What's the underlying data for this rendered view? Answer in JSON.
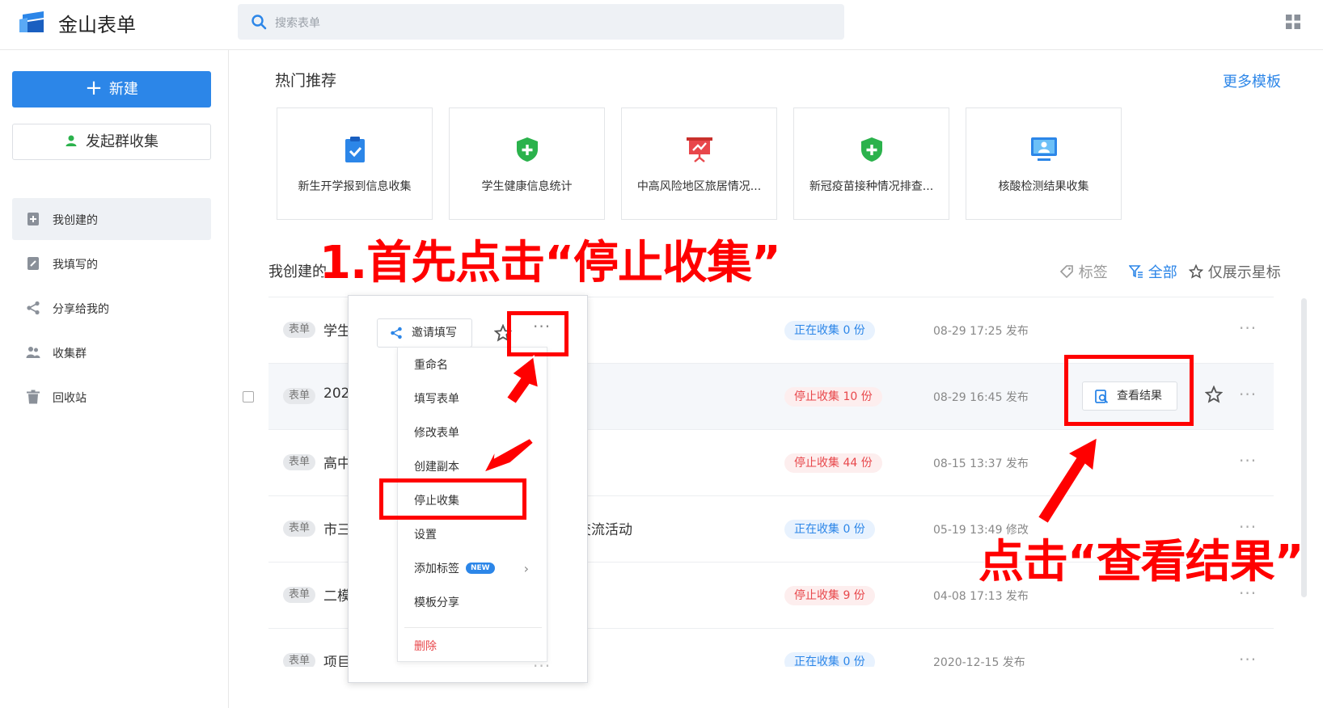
{
  "header": {
    "app_title": "金山表单",
    "search_placeholder": "搜索表单"
  },
  "sidebar": {
    "new_button": "新建",
    "group_collect_button": "发起群收集",
    "items": [
      {
        "label": "我创建的",
        "icon": "form-add-icon"
      },
      {
        "label": "我填写的",
        "icon": "form-edit-icon"
      },
      {
        "label": "分享给我的",
        "icon": "share-icon"
      },
      {
        "label": "收集群",
        "icon": "group-icon"
      },
      {
        "label": "回收站",
        "icon": "trash-icon"
      }
    ]
  },
  "hot": {
    "title": "热门推荐",
    "more": "更多模板",
    "templates": [
      {
        "label": "新生开学报到信息收集",
        "icon": "clipboard-check-icon",
        "color": "#2c86e8"
      },
      {
        "label": "学生健康信息统计",
        "icon": "shield-plus-icon",
        "color": "#2bb24c"
      },
      {
        "label": "中高风险地区旅居情况...",
        "icon": "presentation-chart-icon",
        "color": "#e8474b"
      },
      {
        "label": "新冠疫苗接种情况排查...",
        "icon": "shield-plus-icon",
        "color": "#2bb24c"
      },
      {
        "label": "核酸检测结果收集",
        "icon": "monitor-user-icon",
        "color": "#2c86e8"
      }
    ]
  },
  "mine": {
    "title": "我创建的",
    "filter_tag": "标签",
    "filter_all": "全部",
    "filter_star": "仅展示星标",
    "type_badge": "表单",
    "view_results": "查看结果",
    "rows": [
      {
        "title": "学生",
        "status": "正在收集 0 份",
        "state": "open",
        "date": "08-29 17:25 发布"
      },
      {
        "title": "202",
        "status": "停止收集 10 份",
        "state": "closed",
        "date": "08-29 16:45 发布"
      },
      {
        "title": "高中",
        "status": "停止收集 44 份",
        "state": "closed",
        "date": "08-15 13:37 发布"
      },
      {
        "title": "市三",
        "title_tail": "交流活动",
        "status": "正在收集 0 份",
        "state": "open",
        "date": "05-19 13:49 修改"
      },
      {
        "title": "二模",
        "status": "停止收集 9 份",
        "state": "closed",
        "date": "04-08 17:13 发布"
      },
      {
        "title": "项目",
        "status": "正在收集 0 份",
        "state": "open",
        "date": "2020-12-15 发布"
      }
    ]
  },
  "popup": {
    "invite": "邀请填写",
    "menu": [
      "重命名",
      "填写表单",
      "修改表单",
      "创建副本",
      "停止收集",
      "设置",
      "添加标签",
      "模板分享",
      "删除"
    ],
    "new_badge": "NEW"
  },
  "annotations": {
    "step1": "1.首先点击“停止收集”",
    "step2": "点击“查看结果”"
  },
  "colors": {
    "accent": "#2c86e8",
    "danger": "#e8474b",
    "annotation": "#ff0000"
  }
}
